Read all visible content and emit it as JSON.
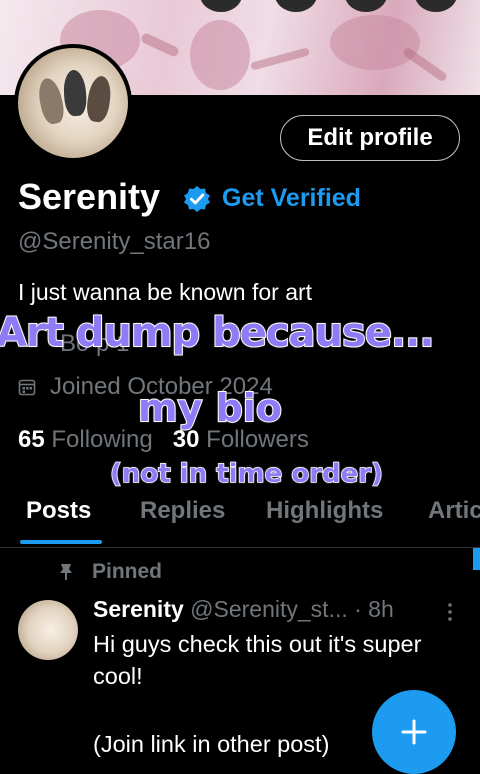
{
  "profile": {
    "edit_button": "Edit profile",
    "name": "Serenity",
    "get_verified": "Get Verified",
    "handle": "@Serenity_star16",
    "bio": "I just wanna be known for art",
    "partial_line": "Bo         p  1",
    "joined": "Joined October 2024",
    "following_count": "65",
    "following_label": "Following",
    "followers_count": "30",
    "followers_label": "Followers"
  },
  "overlay": {
    "line1": "Art dump because...",
    "line2": "my bio",
    "line3": "(not in time order)",
    "color": "#8e7cf6"
  },
  "tabs": [
    "Posts",
    "Replies",
    "Highlights",
    "Artic"
  ],
  "post": {
    "pinned_label": "Pinned",
    "author": "Serenity",
    "handle": "@Serenity_st...",
    "time": "· 8h",
    "text": "Hi guys check this out it's super cool!",
    "text2": "(Join link in other post)"
  },
  "colors": {
    "accent": "#1d9bf0",
    "background": "#000000",
    "muted": "#71767b"
  },
  "icons": [
    "verified-badge-icon",
    "calendar-icon",
    "pin-icon",
    "more-options-icon",
    "plus-icon"
  ]
}
